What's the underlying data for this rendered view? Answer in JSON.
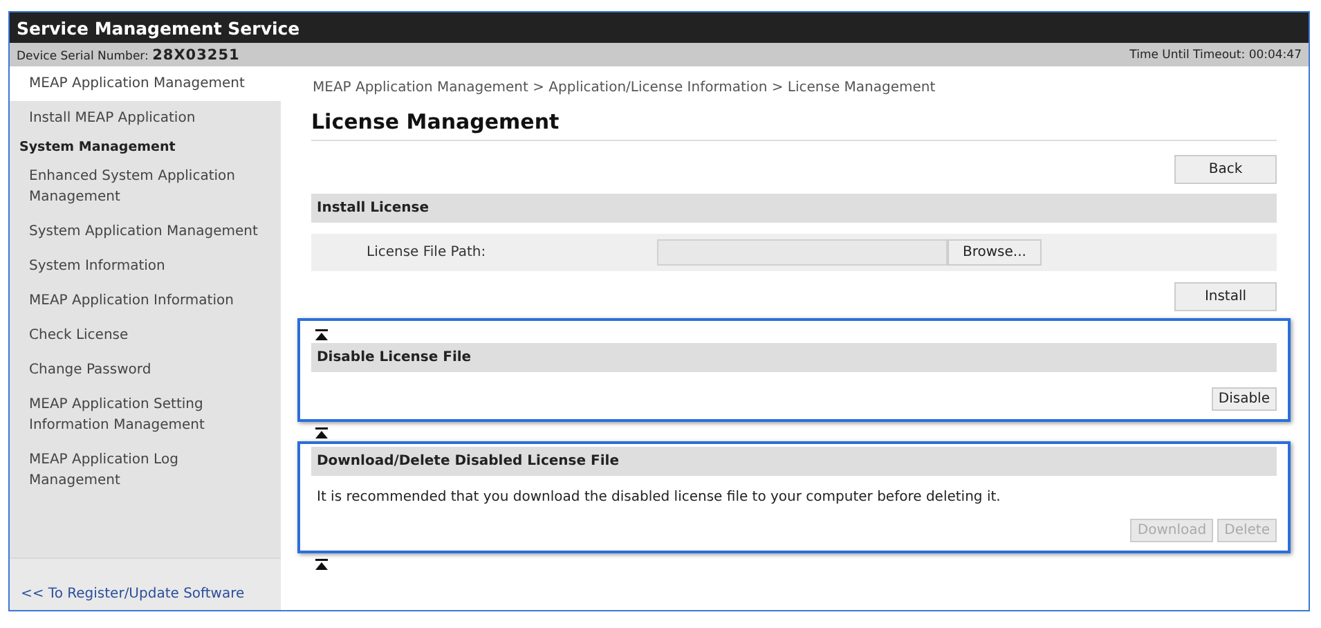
{
  "window": {
    "title": "Service Management Service"
  },
  "info_bar": {
    "serial_label": "Device Serial Number:",
    "serial": "28X03251",
    "timeout": "Time Until Timeout: 00:04:47"
  },
  "sidebar": {
    "items": [
      {
        "kind": "item",
        "label": "MEAP Application Management",
        "selected": true
      },
      {
        "kind": "item",
        "label": "Install MEAP Application",
        "selected": false
      },
      {
        "kind": "heading",
        "label": "System Management"
      },
      {
        "kind": "item",
        "label": "Enhanced System Application Management",
        "selected": false
      },
      {
        "kind": "item",
        "label": "System Application Management",
        "selected": false
      },
      {
        "kind": "item",
        "label": "System Information",
        "selected": false
      },
      {
        "kind": "item",
        "label": "MEAP Application Information",
        "selected": false
      },
      {
        "kind": "item",
        "label": "Check License",
        "selected": false
      },
      {
        "kind": "item",
        "label": "Change Password",
        "selected": false
      },
      {
        "kind": "item",
        "label": "MEAP Application Setting Information Management",
        "selected": false
      },
      {
        "kind": "item",
        "label": "MEAP Application Log Management",
        "selected": false
      }
    ],
    "footer_link": "<< To Register/Update Software"
  },
  "breadcrumb": "MEAP Application Management > Application/License Information > License Management",
  "page_title": "License Management",
  "back_button": "Back",
  "sections": [
    {
      "kind": "install",
      "title": "Install License",
      "highlighted": false,
      "field_label": "License File Path:",
      "browse_button": "Browse...",
      "action_button": "Install",
      "action_disabled": false
    },
    {
      "kind": "disable",
      "title": "Disable License File",
      "highlighted": true,
      "action_button": "Disable",
      "action_disabled": false
    },
    {
      "kind": "download",
      "title": "Download/Delete Disabled License File",
      "highlighted": true,
      "message": "It is recommended that you download the disabled license file to your computer before deleting it.",
      "buttons": [
        {
          "label": "Download",
          "disabled": true
        },
        {
          "label": "Delete",
          "disabled": true
        }
      ]
    }
  ]
}
